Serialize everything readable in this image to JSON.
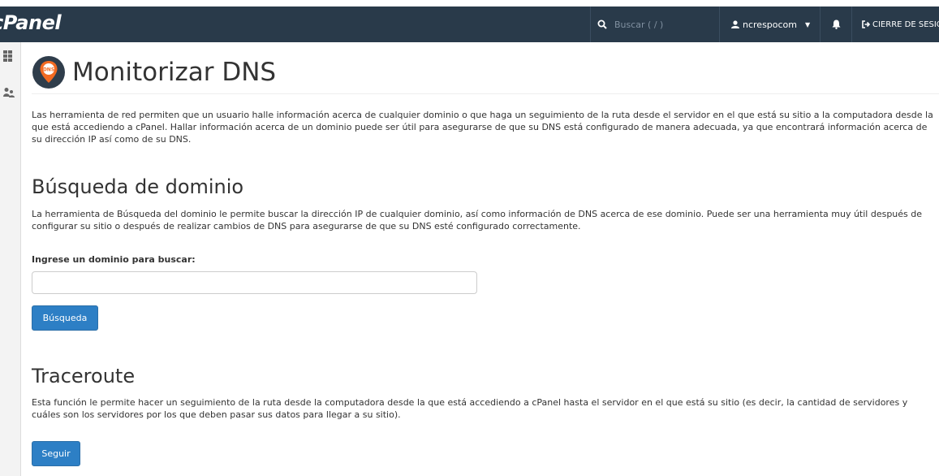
{
  "topbar": {
    "logo": "cPanel",
    "search_placeholder": "Buscar ( / )",
    "username": "ncrespocom",
    "logout_label": "CIERRE DE SESIÓN"
  },
  "page": {
    "title": "Monitorizar DNS",
    "icon_text": "DNS",
    "intro": "Las herramienta de red permiten que un usuario halle información acerca de cualquier dominio o que haga un seguimiento de la ruta desde el servidor en el que está su sitio a la computadora desde la que está accediendo a cPanel. Hallar información acerca de un dominio puede ser útil para asegurarse de que su DNS está configurado de manera adecuada, ya que encontrará información acerca de su dirección IP así como de su DNS."
  },
  "busqueda": {
    "title": "Búsqueda de dominio",
    "description": "La herramienta de Búsqueda del dominio le permite buscar la dirección IP de cualquier dominio, así como información de DNS acerca de ese dominio. Puede ser una herramienta muy útil después de configurar su sitio o después de realizar cambios de DNS para asegurarse de que su DNS esté configurado correctamente.",
    "input_label": "Ingrese un dominio para buscar:",
    "input_value": "",
    "button_label": "Búsqueda"
  },
  "traceroute": {
    "title": "Traceroute",
    "description_line1": "Esta función le permite hacer un seguimiento de la ruta desde la computadora desde la que está accediendo a cPanel hasta el servidor en el que está su sitio (es decir, la cantidad de servidores y",
    "description_line2": "cuáles son los servidores por los que deben pasar sus datos para llegar a su sitio).",
    "button_label": "Seguir"
  },
  "colors": {
    "topbar": "#293a4a",
    "primary_button": "#2d7fc5",
    "dns_icon": "#f26a22"
  }
}
